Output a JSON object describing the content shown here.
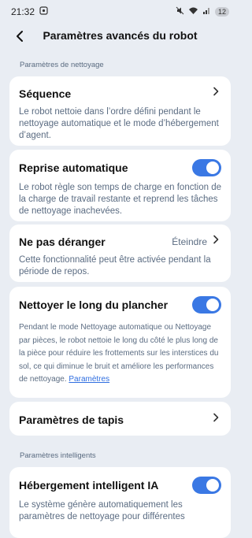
{
  "status_bar": {
    "time": "21:32",
    "battery": "12"
  },
  "header": {
    "title": "Paramètres avancés du robot"
  },
  "sections": {
    "cleaning": "Paramètres de nettoyage",
    "smart": "Paramètres intelligents"
  },
  "items": {
    "sequence": {
      "title": "Séquence",
      "desc": "Le robot nettoie dans l’ordre défini pendant le nettoyage automatique et le mode d’hébergement d’agent."
    },
    "auto_resume": {
      "title": "Reprise automatique",
      "desc": "Le robot règle son temps de charge en fonction de la charge de travail restante et reprend les tâches de nettoyage inachevées.",
      "enabled": true
    },
    "dnd": {
      "title": "Ne pas déranger",
      "value": "Éteindre",
      "desc": "Cette fonctionnalité peut être activée pendant la période de repos."
    },
    "edge_clean": {
      "title": "Nettoyer le long du plancher",
      "desc": "Pendant le mode Nettoyage automatique ou Nettoyage par pièces, le robot nettoie le long du côté le plus long de la pièce pour réduire les frottements sur les interstices du sol, ce qui diminue le bruit et améliore les performances de nettoyage.",
      "link": "Paramètres",
      "enabled": true
    },
    "carpet": {
      "title": "Paramètres de tapis"
    },
    "ai_hosting": {
      "title": "Hébergement intelligent IA",
      "desc": "Le système génère automatiquement les paramètres de nettoyage pour différentes",
      "enabled": true
    }
  },
  "colors": {
    "accent": "#3a78e4",
    "background": "#e9edf3",
    "desc_text": "#5b6c82"
  }
}
